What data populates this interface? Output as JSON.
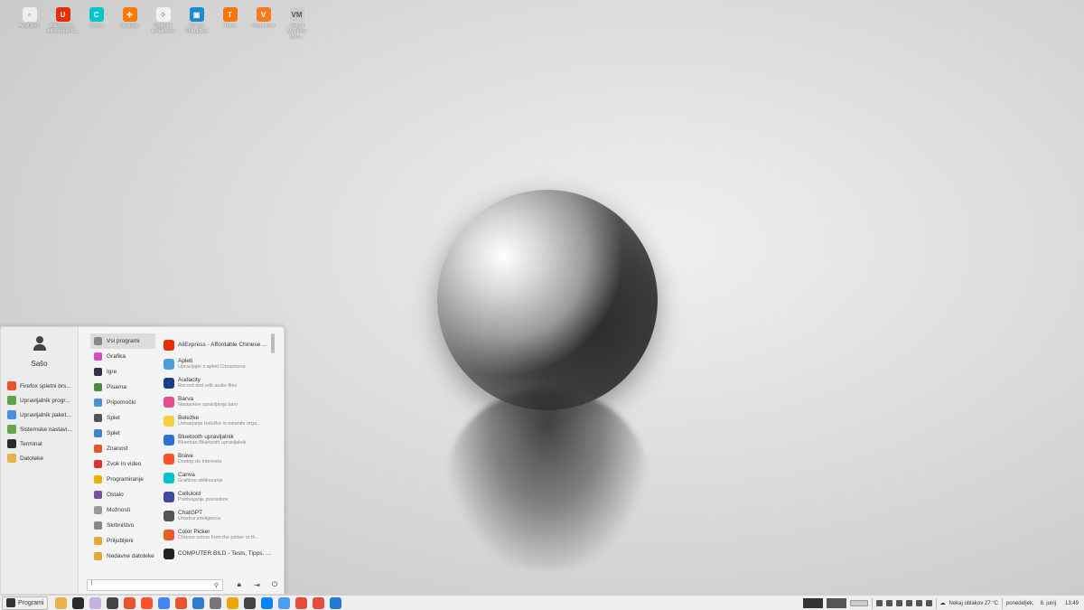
{
  "desktop_icons": [
    {
      "label": "AnyDesk",
      "color": "#eeeeee",
      "glyph": "▫"
    },
    {
      "label": "AliExpress - Affordable C...",
      "color": "#e62e04",
      "glyph": "U"
    },
    {
      "label": "Canva",
      "color": "#00c4cc",
      "glyph": "C"
    },
    {
      "label": "Desktop",
      "color": "#ff7a00",
      "glyph": "✣"
    },
    {
      "label": "Digitalni trofeji.com",
      "color": "#f2f2f2",
      "glyph": "⁘"
    },
    {
      "label": "Oracle VirtualBox",
      "color": "#1a8bd1",
      "glyph": "▣"
    },
    {
      "label": "Temu",
      "color": "#fb7701",
      "glyph": "T"
    },
    {
      "label": "Victor.com",
      "color": "#f47b20",
      "glyph": "V"
    },
    {
      "label": "Virtual Machine Man...",
      "color": "#cccccc",
      "glyph": "VM"
    }
  ],
  "menu": {
    "user_name": "Sašo",
    "favorites": [
      {
        "label": "Firefox spletni brs...",
        "color": "#e8542c"
      },
      {
        "label": "Upravljalnik progr...",
        "color": "#5ea346"
      },
      {
        "label": "Upravljalnik paket...",
        "color": "#4a90d9"
      },
      {
        "label": "Sistemske nastavi...",
        "color": "#6ca64b"
      },
      {
        "label": "Terminal",
        "color": "#2b2b2b"
      },
      {
        "label": "Datoteke",
        "color": "#e9b24a"
      }
    ],
    "categories": [
      {
        "label": "Vsi programi",
        "color": "#888888"
      },
      {
        "label": "Grafika",
        "color": "#d64ac8"
      },
      {
        "label": "Igre",
        "color": "#333344"
      },
      {
        "label": "Pisarna",
        "color": "#4a8e3d"
      },
      {
        "label": "Pripomočki",
        "color": "#4a90d9"
      },
      {
        "label": "Splet",
        "color": "#555555"
      },
      {
        "label": "Splet",
        "color": "#3f83d8"
      },
      {
        "label": "Znanost",
        "color": "#e8542c"
      },
      {
        "label": "Zvok in video",
        "color": "#d93434"
      },
      {
        "label": "Programiranje",
        "color": "#e9b200"
      },
      {
        "label": "Ostalo",
        "color": "#7a4fa0"
      },
      {
        "label": "Možnosti",
        "color": "#999999"
      },
      {
        "label": "Skrbništvo",
        "color": "#888888"
      },
      {
        "label": "Priljubljeni",
        "color": "#e9a43a"
      },
      {
        "label": "Nedavne datoteke",
        "color": "#e9a43a"
      }
    ],
    "apps": [
      {
        "name": "AliExpress - Affordable Chinese ...",
        "desc": "",
        "color": "#e62e04"
      },
      {
        "name": "Apleti",
        "desc": "Upravljajte z apleti Cinnamona",
        "color": "#4a9ee0"
      },
      {
        "name": "Audacity",
        "desc": "Record and edit audio files",
        "color": "#1a3e8c"
      },
      {
        "name": "Barva",
        "desc": "Nastavitve upravljanja barv",
        "color": "#e74c8c"
      },
      {
        "name": "Beležke",
        "desc": "Ustvarjanje beležke in ostanite orga...",
        "color": "#f4d03f"
      },
      {
        "name": "Bluetooth upravljalnik",
        "desc": "Blueman Bluetooth upravljalnik",
        "color": "#2d6fd6"
      },
      {
        "name": "Brave",
        "desc": "Dostop do interneta",
        "color": "#fb542b"
      },
      {
        "name": "Canva",
        "desc": "Grafično oblikovanje",
        "color": "#00c4cc"
      },
      {
        "name": "Celluloid",
        "desc": "Predvajanje posnetkov",
        "color": "#3f4c9e"
      },
      {
        "name": "ChatGPT",
        "desc": "Umetna inteligenca",
        "color": "#555555"
      },
      {
        "name": "Color Picker",
        "desc": "Choose colors from the picker or th...",
        "color": "#e85d2c"
      },
      {
        "name": "COMPUTER BILD - Tests, Tipps, N...",
        "desc": "",
        "color": "#222222"
      }
    ],
    "search_value": "|"
  },
  "taskbar": {
    "menu_label": "Programi",
    "launchers": [
      "#e9b24a",
      "#2b2b2b",
      "#c7b1e3",
      "#444444",
      "#e8542c",
      "#fb542b",
      "#4285f4",
      "#e8542c",
      "#2e7bd6",
      "#777777",
      "#f0a500",
      "#444444",
      "#0084ff",
      "#4b9cf5",
      "#e74c3c",
      "#e84c3d",
      "#1f7bd6"
    ],
    "weather": "Nekaj oblakov 27 °C",
    "day": "ponedeljek,",
    "date": "8. junij",
    "time": "13:49"
  }
}
